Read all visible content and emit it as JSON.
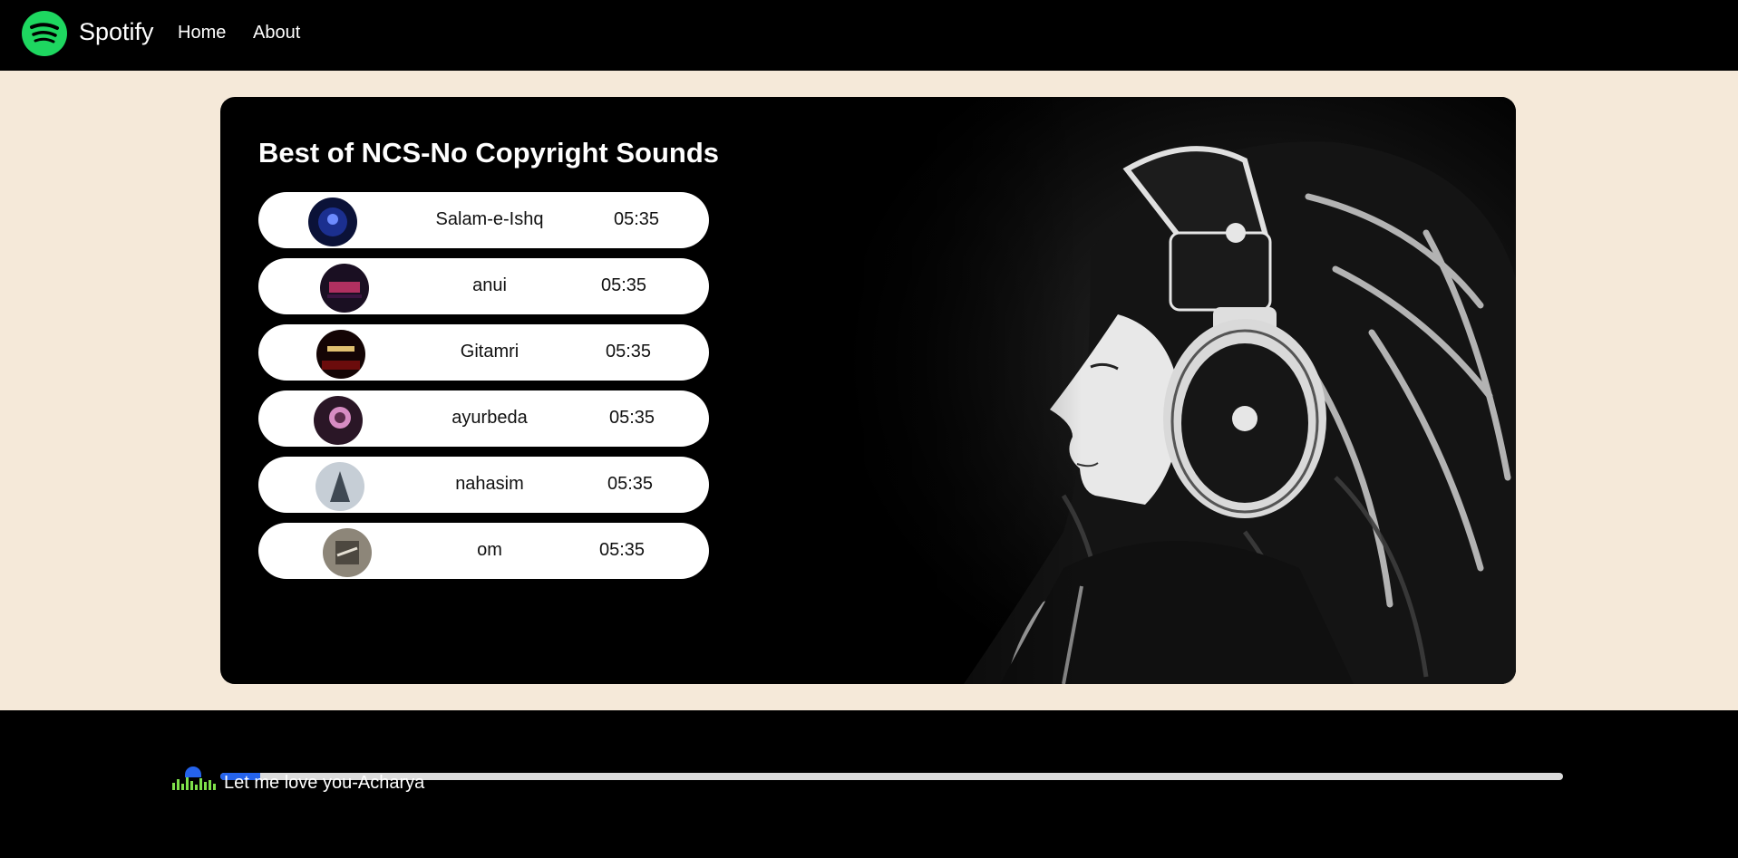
{
  "nav": {
    "brand": "Spotify",
    "links": [
      "Home",
      "About"
    ]
  },
  "playlist": {
    "title": "Best of NCS-No Copyright Sounds",
    "songs": [
      {
        "name": "Salam-e-Ishq",
        "duration": "05:35",
        "cover_color": "#1b2f8f"
      },
      {
        "name": "anui",
        "duration": "05:35",
        "cover_color": "#3a1440"
      },
      {
        "name": "Gitamri",
        "duration": "05:35",
        "cover_color": "#3b0a0a"
      },
      {
        "name": "ayurbeda",
        "duration": "05:35",
        "cover_color": "#5a2c4b"
      },
      {
        "name": "nahasim",
        "duration": "05:35",
        "cover_color": "#5c6672"
      },
      {
        "name": "om",
        "duration": "05:35",
        "cover_color": "#6b665e"
      }
    ]
  },
  "player": {
    "now_playing": "Let me love you-Acharya",
    "progress_percent": 3
  },
  "colors": {
    "accent": "#1ed760",
    "page_bg": "#f5e9d9",
    "progress": "#2563eb"
  }
}
